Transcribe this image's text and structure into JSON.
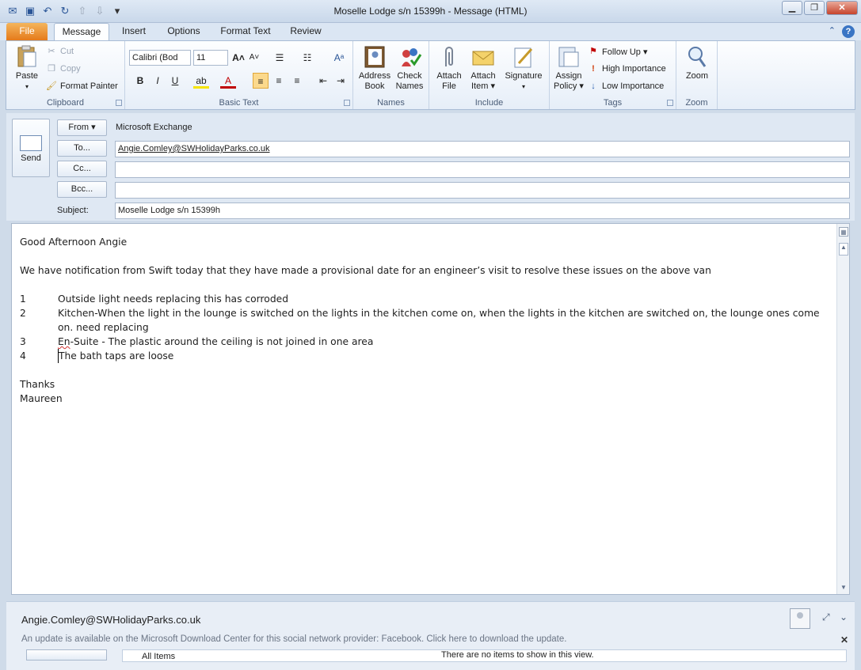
{
  "window": {
    "title": "Moselle Lodge s/n 15399h  -  Message (HTML)",
    "controls": {
      "minimize": "▭",
      "restore": "❐",
      "close": "✕"
    }
  },
  "qat": {
    "icons": [
      "outlook-icon",
      "save-icon",
      "undo-icon",
      "redo-icon",
      "up-icon",
      "down-icon",
      "customize-icon"
    ]
  },
  "tabs": {
    "file": "File",
    "message": "Message",
    "insert": "Insert",
    "options": "Options",
    "format_text": "Format Text",
    "review": "Review"
  },
  "ribbon": {
    "clipboard": {
      "label": "Clipboard",
      "paste": "Paste",
      "cut": "Cut",
      "copy": "Copy",
      "format_painter": "Format Painter"
    },
    "basic_text": {
      "label": "Basic Text",
      "font": "Calibri (Bod",
      "size": "11",
      "bold": "B",
      "italic": "I",
      "underline": "U"
    },
    "names": {
      "label": "Names",
      "address_book": "Address\nBook",
      "address_book_1": "Address",
      "address_book_2": "Book",
      "check_names_1": "Check",
      "check_names_2": "Names"
    },
    "include": {
      "label": "Include",
      "attach_file_1": "Attach",
      "attach_file_2": "File",
      "attach_item_1": "Attach",
      "attach_item_2": "Item ▾",
      "signature": "Signature"
    },
    "tags": {
      "label": "Tags",
      "assign_policy_1": "Assign",
      "assign_policy_2": "Policy ▾",
      "follow_up": "Follow Up ▾",
      "high_importance": "High Importance",
      "low_importance": "Low Importance"
    },
    "zoom": {
      "label": "Zoom",
      "zoom": "Zoom"
    }
  },
  "header": {
    "send": "Send",
    "from_btn": "From ▾",
    "from_value": "Microsoft Exchange",
    "to_btn": "To...",
    "to_value": "Angie.Comley@SWHolidayParks.co.uk",
    "cc_btn": "Cc...",
    "bcc_btn": "Bcc...",
    "subject_label": "Subject:",
    "subject_value": "Moselle Lodge s/n 15399h"
  },
  "body": {
    "greeting": "Good Afternoon Angie",
    "intro": "We have notification from Swift today that they have made a provisional date for an engineer’s visit to resolve these issues on the above van",
    "items": [
      {
        "num": "1",
        "text": "Outside light needs replacing this has corroded"
      },
      {
        "num": "2",
        "text": "Kitchen-When the light in the lounge is switched on the lights in the kitchen come on, when the lights in the kitchen are switched on, the lounge ones come on. need replacing"
      },
      {
        "num": "3",
        "text_a": "En",
        "text_b": "-Suite - The plastic around the ceiling is not joined in one area"
      },
      {
        "num": "4",
        "text": "The bath taps are loose"
      }
    ],
    "closing": "Thanks",
    "signature": "Maureen"
  },
  "people_pane": {
    "name": "Angie.Comley@SWHolidayParks.co.uk",
    "update_notice": "An update is available on the Microsoft Download Center for this social network provider: Facebook. Click here to download the update.",
    "all_items": "All Items",
    "empty_message": "There are no items to show in this view."
  }
}
